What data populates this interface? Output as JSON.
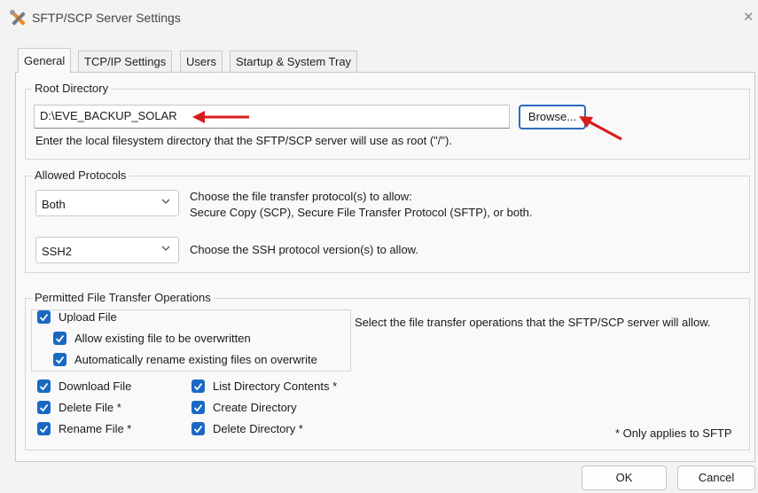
{
  "window": {
    "title": "SFTP/SCP Server Settings"
  },
  "tabs": [
    "General",
    "TCP/IP Settings",
    "Users",
    "Startup & System Tray"
  ],
  "root_directory": {
    "legend": "Root Directory",
    "value": "D:\\EVE_BACKUP_SOLAR",
    "browse_label": "Browse...",
    "hint": "Enter the local filesystem directory that the SFTP/SCP server will use as root (\"/\")."
  },
  "allowed_protocols": {
    "legend": "Allowed Protocols",
    "protocol_value": "Both",
    "protocol_desc_1": "Choose the file transfer protocol(s) to allow:",
    "protocol_desc_2": "Secure Copy (SCP), Secure File Transfer Protocol (SFTP), or both.",
    "ssh_value": "SSH2",
    "ssh_desc": "Choose the SSH protocol version(s) to allow."
  },
  "operations": {
    "legend": "Permitted File Transfer Operations",
    "upload": "Upload File",
    "allow_overwrite": "Allow existing file to be overwritten",
    "auto_rename": "Automatically rename existing files on overwrite",
    "download": "Download File",
    "delete": "Delete File *",
    "rename": "Rename File *",
    "list_dir": "List Directory Contents *",
    "create_dir": "Create Directory",
    "delete_dir": "Delete Directory *",
    "description": "Select the file transfer operations that the SFTP/SCP server will allow.",
    "footnote": "* Only applies to SFTP"
  },
  "buttons": {
    "ok": "OK",
    "cancel": "Cancel"
  },
  "colors": {
    "accent": "#1a68c4",
    "annotation": "#d81b1b"
  }
}
